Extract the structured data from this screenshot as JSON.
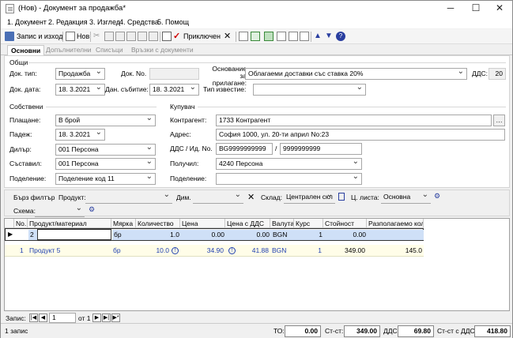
{
  "window": {
    "title": "(Нов) - Документ за продажба*"
  },
  "menu": [
    "1. Документ",
    "2. Редакция",
    "3. Изглед",
    "4. Средства",
    "5. Помощ"
  ],
  "toolbar": {
    "save_exit": "Запис и изход",
    "new": "Нов",
    "confirmed": "Приключен"
  },
  "tabs": [
    "Основни",
    "Допълнителни",
    "Списъци",
    "Връзки с документи"
  ],
  "general": {
    "group": "Общи",
    "doc_type_label": "Док. тип:",
    "doc_type": "Продажба",
    "doc_no_label": "Док. No.",
    "doc_no": "",
    "basis_label": "Основание за прилагане:",
    "basis": "Облагаеми доставки със ставка 20%",
    "vat_label": "ДДС:",
    "vat": "20",
    "doc_date_label": "Док. дата:",
    "doc_date": "18. 3.2021",
    "tax_event_label": "Дан. събитие:",
    "tax_event": "18. 3.2021",
    "notice_type_label": "Тип известие:",
    "notice_type": ""
  },
  "own": {
    "group": "Собствени",
    "payment_label": "Плащане:",
    "payment": "В брой",
    "due_label": "Падеж:",
    "due": "18. 3.2021",
    "dealer_label": "Дилър:",
    "dealer": "001 Персона",
    "author_label": "Съставил:",
    "author": "001 Персона",
    "division_label": "Поделение:",
    "division": "Поделение код 11"
  },
  "buyer": {
    "group": "Купувач",
    "contractor_label": "Контрагент:",
    "contractor": "1733 Контрагент",
    "address_label": "Адрес:",
    "address": "София 1000, ул. 20-ти април No:23",
    "vatid_label": "ДДС / Ид. No.",
    "vat_no": "BG9999999999",
    "id_no": "9999999999",
    "receiver_label": "Получил:",
    "receiver": "4240 Персона",
    "division_label": "Поделение:",
    "division": ""
  },
  "filter": {
    "quick_label": "Бърз филтър",
    "product_label": "Продукт:",
    "dim_label": "Дим.",
    "warehouse_label": "Склад:",
    "warehouse": "Централен скл",
    "pricelist_label": "Ц. листа:",
    "pricelist": "Основна",
    "scheme_label": "Схема:"
  },
  "grid": {
    "headers": [
      "No.",
      "Продукт/материал",
      "Мярка",
      "Количество",
      "Цена",
      "Цена с ДДС",
      "Валута",
      "Курс",
      "Стойност",
      "Разполагаемо кол."
    ],
    "row_new": {
      "no": "2",
      "product": "",
      "unit": "бр",
      "qty": "1.0",
      "price": "0.00",
      "price_vat": "0.00",
      "currency": "BGN",
      "rate": "1",
      "value": "0.00",
      "avail": ""
    },
    "row1": {
      "no": "1",
      "product": "Продукт 5",
      "unit": "бр",
      "qty": "10.0",
      "price": "34.90",
      "price_vat": "41.88",
      "currency": "BGN",
      "rate": "1",
      "value": "349.00",
      "avail": "145.0"
    }
  },
  "nav": {
    "label": "Запис:",
    "page": "1",
    "of": "от 1"
  },
  "status": {
    "records": "1 запис",
    "to_label": "ТО:",
    "to": "0.00",
    "net_label": "Ст-ст:",
    "net": "349.00",
    "vat_label": "ДДС:",
    "vat": "69.80",
    "total_label": "Ст-ст с ДДС:",
    "total": "418.80"
  }
}
